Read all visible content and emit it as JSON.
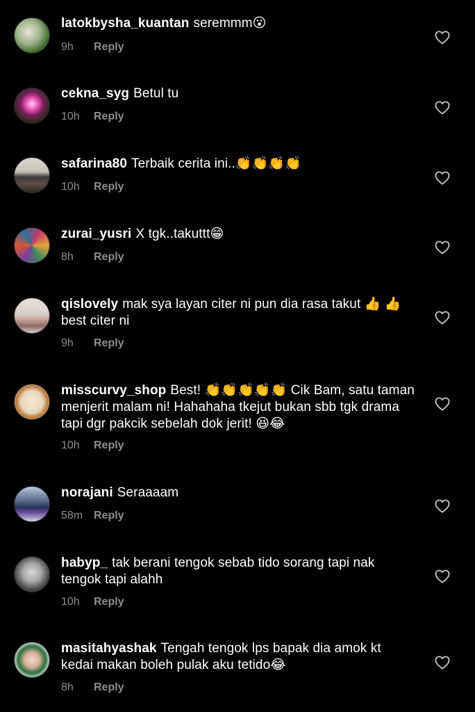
{
  "comments": [
    {
      "username": "latokbysha_kuantan",
      "text": "seremmm😮",
      "time": "9h",
      "reply": "Reply"
    },
    {
      "username": "cekna_syg",
      "text": "Betul tu",
      "time": "10h",
      "reply": "Reply"
    },
    {
      "username": "safarina80",
      "text": "Terbaik cerita ini..👏👏👏👏",
      "time": "10h",
      "reply": "Reply"
    },
    {
      "username": "zurai_yusri",
      "text": "X tgk..takuttt😁",
      "time": "8h",
      "reply": "Reply"
    },
    {
      "username": "qislovely",
      "text": "mak sya layan citer ni pun dia rasa takut 👍 👍 best citer ni",
      "time": "9h",
      "reply": "Reply"
    },
    {
      "username": "misscurvy_shop",
      "text": "Best! 👏👏👏👏👏 Cik Bam, satu taman menjerit malam ni! Hahahaha tkejut bukan sbb tgk drama tapi dgr pakcik sebelah dok jerit! 😆😂",
      "time": "10h",
      "reply": "Reply"
    },
    {
      "username": "norajani",
      "text": "Seraaaam",
      "time": "58m",
      "reply": "Reply"
    },
    {
      "username": "habyp_",
      "text": "tak berani tengok sebab tido sorang tapi nak tengok tapi alahh",
      "time": "10h",
      "reply": "Reply"
    },
    {
      "username": "masitahyashak",
      "text": "Tengah tengok lps bapak dia amok  kt kedai makan boleh pulak aku tetido😂",
      "time": "8h",
      "reply": "Reply"
    }
  ],
  "icons": {
    "like": "heart-outline-icon"
  },
  "colors": {
    "background": "#000000",
    "text": "#ffffff",
    "meta": "#8e8e8e"
  }
}
